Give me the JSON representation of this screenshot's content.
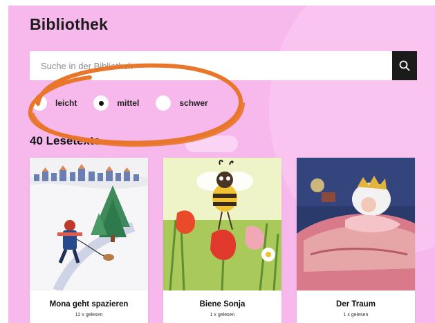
{
  "page": {
    "title": "Bibliothek"
  },
  "search": {
    "placeholder": "Suche in der Bibliothek",
    "value": ""
  },
  "levels": [
    {
      "label": "leicht",
      "selected": false
    },
    {
      "label": "mittel",
      "selected": true
    },
    {
      "label": "schwer",
      "selected": false
    }
  ],
  "results": {
    "count_label": "40 Lesetexte"
  },
  "cards": [
    {
      "title": "Mona geht spazieren",
      "meta": "12 x gelesen"
    },
    {
      "title": "Biene Sonja",
      "meta": "1 x gelesen"
    },
    {
      "title": "Der Traum",
      "meta": "1 x gelesen"
    }
  ],
  "colors": {
    "background": "#f7b8ec",
    "annotation": "#e8762b",
    "search_button": "#1b1b1b"
  },
  "icons": {
    "search": "search-icon"
  }
}
